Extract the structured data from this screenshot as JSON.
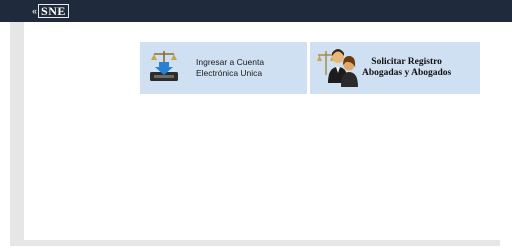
{
  "header": {
    "logo_text": "SNE",
    "logo_mark": "«",
    "background": "#1f2a3c"
  },
  "tiles": {
    "ingresar": {
      "line1": "Ingresar a Cuenta",
      "line2": "Electrónica Unica",
      "icon": "scales-download-inbox-icon",
      "background": "#cfe0f2"
    },
    "solicitar": {
      "line1": "Solicitar Registro",
      "line2": "Abogadas y Abogados",
      "icon": "lawyers-scales-icon",
      "background": "#cfe0f2"
    }
  }
}
